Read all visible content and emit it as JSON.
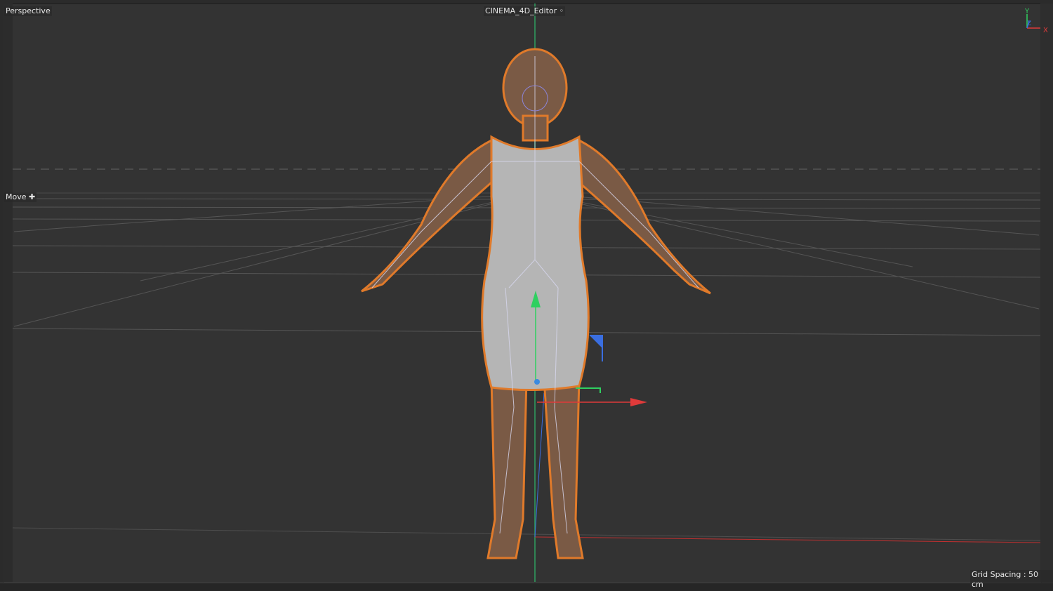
{
  "viewport": {
    "camera_label": "Perspective",
    "camera_name": "CINEMA_4D_Editor",
    "camera_icon": "camera-icon",
    "tool_label": "Move",
    "tool_icon": "move-cross-icon",
    "grid_spacing": "Grid Spacing : 50 cm",
    "axis_labels": {
      "y": "Y",
      "z": "Z",
      "x": "X"
    }
  },
  "colors": {
    "x_axis": "#e03a3a",
    "y_axis": "#2fd060",
    "z_axis": "#3a6ee0",
    "selection": "#e07a2a"
  }
}
